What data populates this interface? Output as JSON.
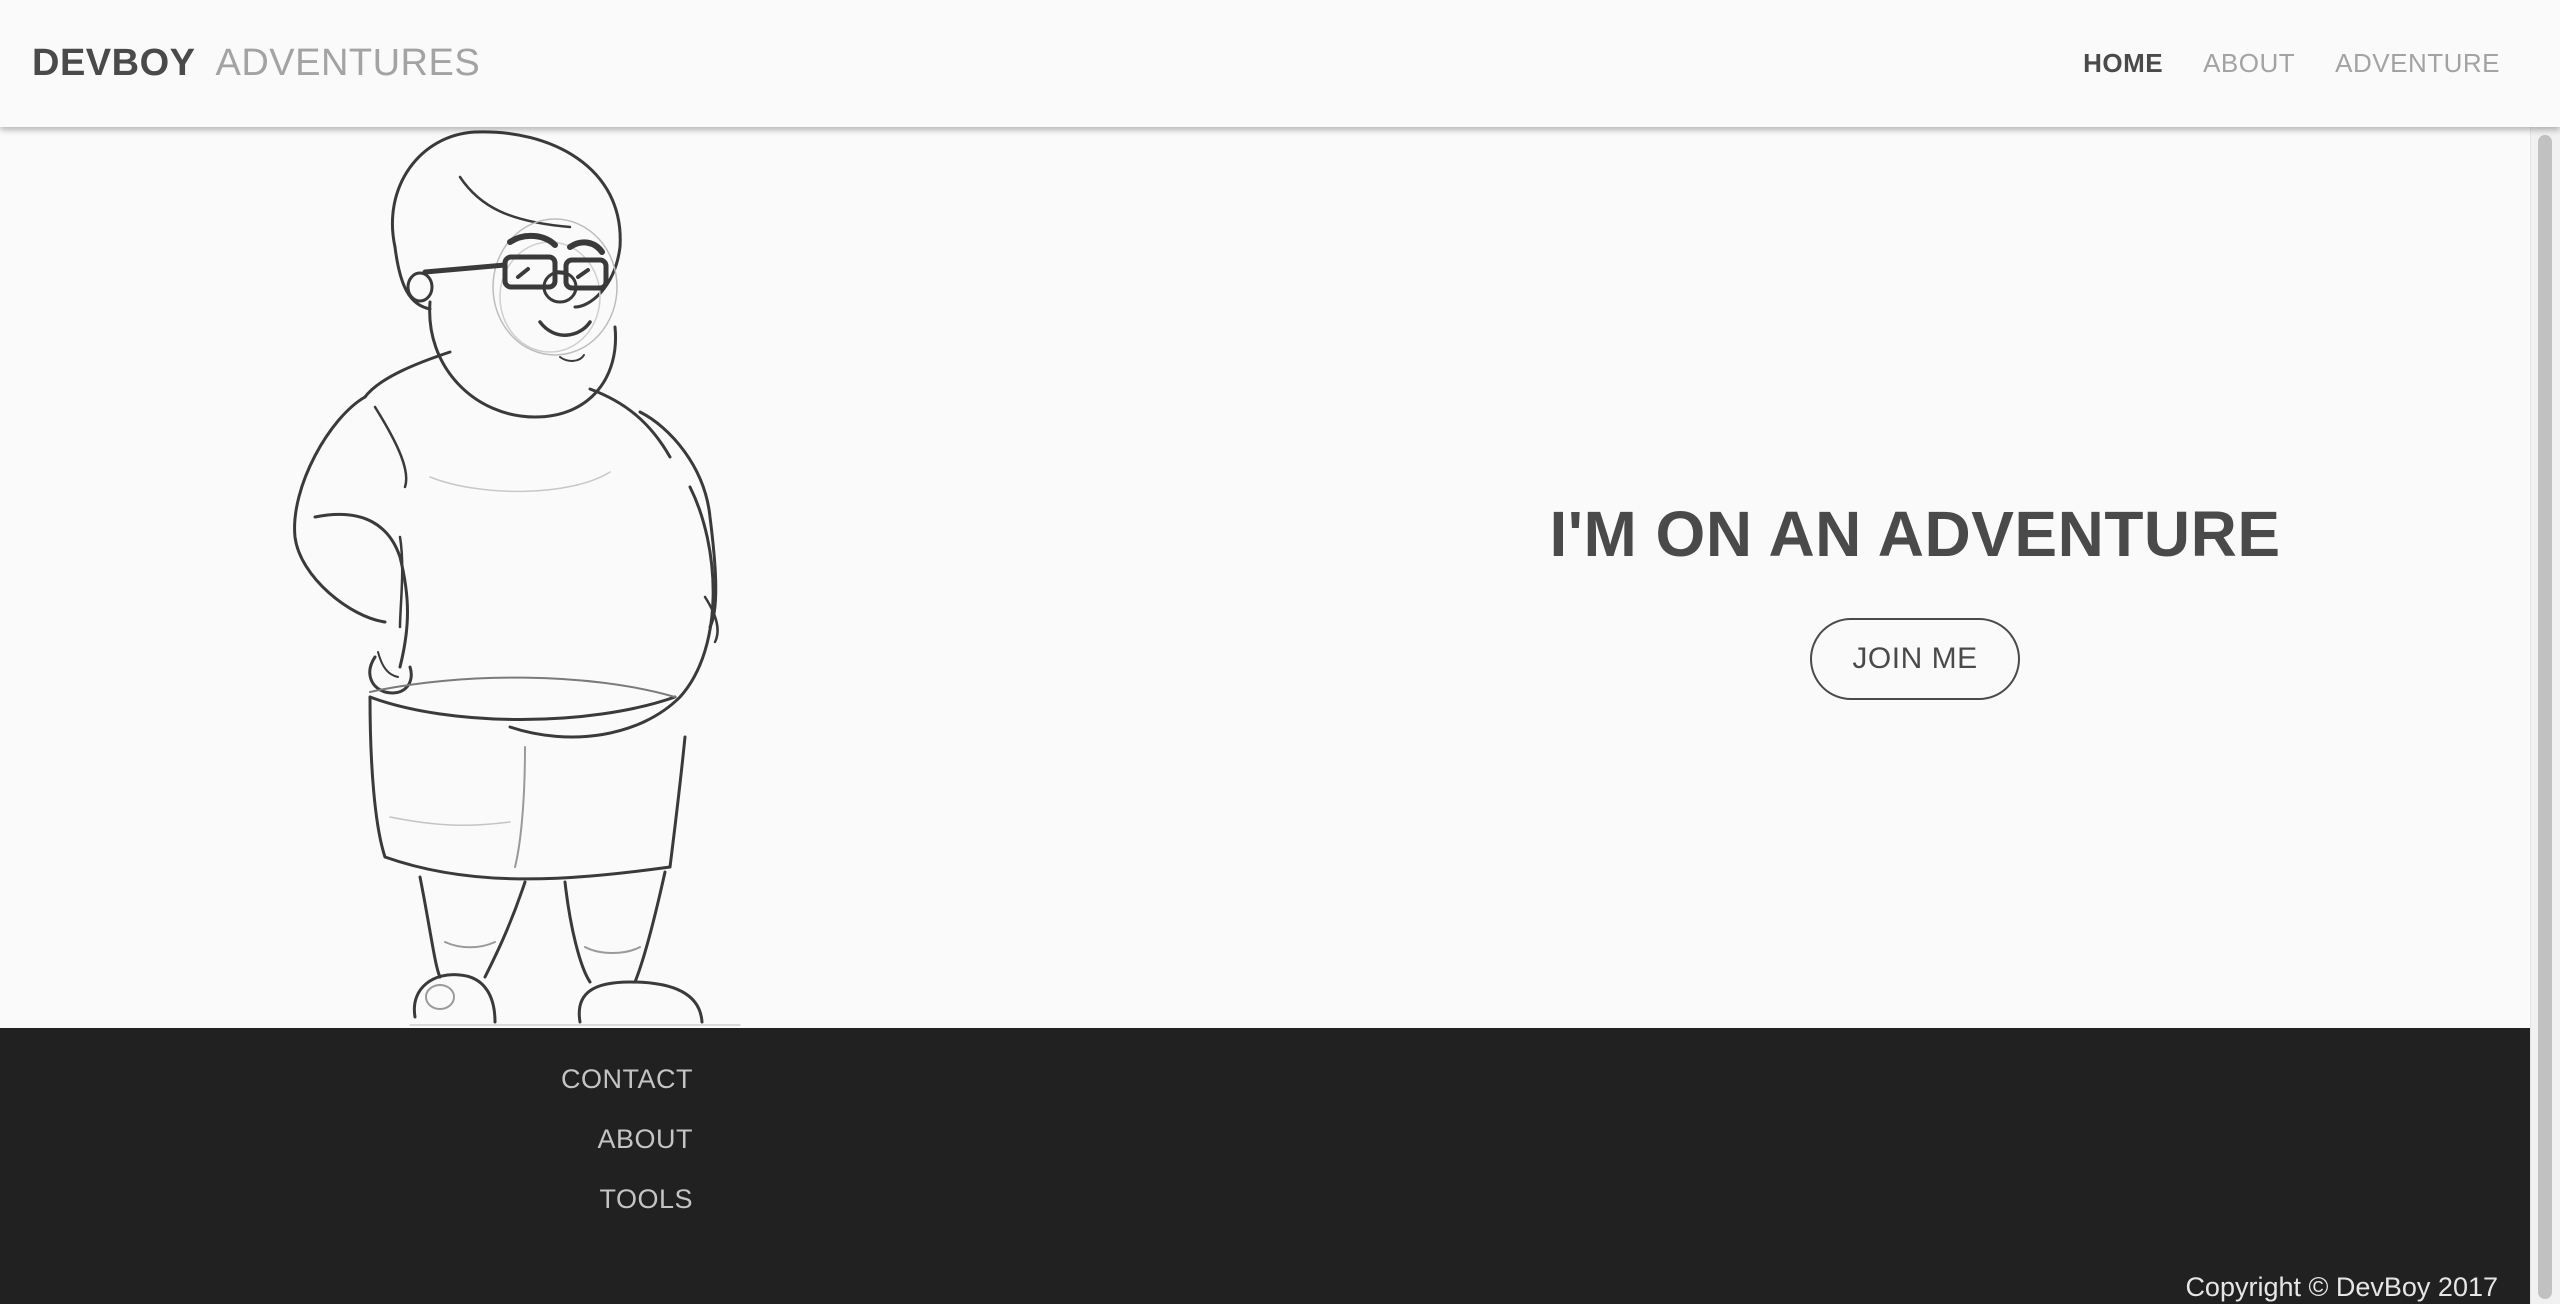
{
  "header": {
    "brand_bold": "DEVBOY",
    "brand_light": "ADVENTURES",
    "nav": [
      {
        "label": "HOME",
        "active": true
      },
      {
        "label": "ABOUT",
        "active": false
      },
      {
        "label": "ADVENTURE",
        "active": false
      }
    ]
  },
  "hero": {
    "tagline": "I'M ON AN ADVENTURE",
    "cta_label": "JOIN ME",
    "illustration": "character-sketch"
  },
  "footer": {
    "links": [
      "CONTACT",
      "ABOUT",
      "TOOLS"
    ],
    "copyright": "Copyright © DevBoy 2017"
  },
  "colors": {
    "page_bg": "#fafafa",
    "text_dark": "#4a4a4a",
    "text_muted": "#a3a3a3",
    "footer_bg": "#212121",
    "footer_link": "#c4c4c4"
  }
}
